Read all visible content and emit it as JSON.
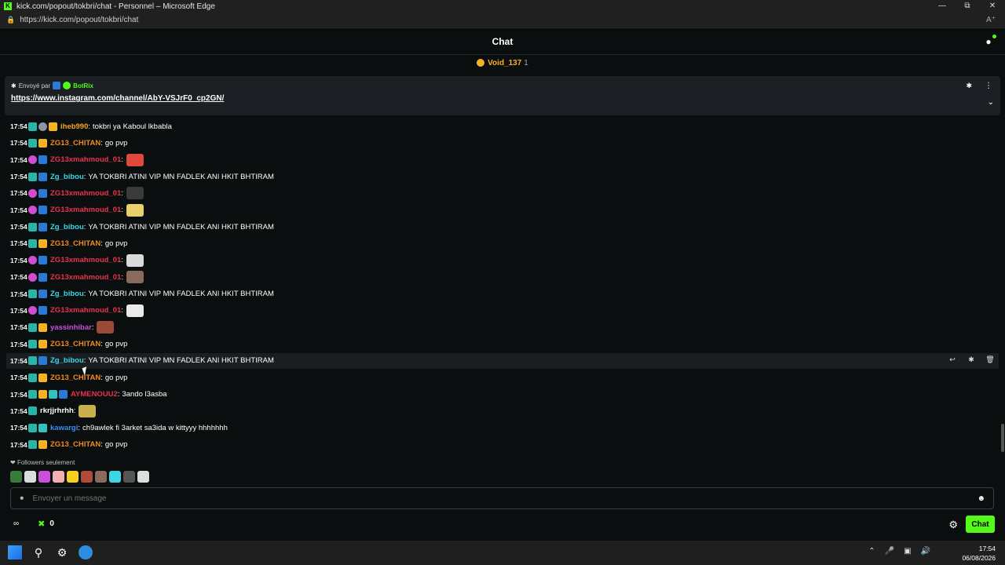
{
  "browser": {
    "window_title": "kick.com/popout/tokbri/chat - Personnel – Microsoft Edge",
    "url": "https://kick.com/popout/tokbri/chat",
    "reader_icon": "Aͅ"
  },
  "chat": {
    "title": "Chat",
    "top_gifter": {
      "name": "Void_137",
      "count": "1"
    },
    "pinned": {
      "sent_by_label": "Envoyé par",
      "sender": "BotRix",
      "link": "https://www.instagram.com/channel/AbY-VSJrF0_cp2GN/"
    },
    "messages": [
      {
        "time": "17:54",
        "badges": [
          "sub",
          "gray",
          "crown"
        ],
        "user": "iheb990",
        "color": "#f5a623",
        "text": "tokbri ya Kaboul lkbabla",
        "emote": ""
      },
      {
        "time": "17:54",
        "badges": [
          "sub",
          "crown"
        ],
        "user": "ZG13_CHITAN",
        "color": "#f58a1f",
        "text": "go pvp",
        "emote": ""
      },
      {
        "time": "17:54",
        "badges": [
          "pink",
          "star"
        ],
        "user": "ZG13xmahmoud_01",
        "color": "#e8334a",
        "text": "",
        "emote": "#e0483b"
      },
      {
        "time": "17:54",
        "badges": [
          "sub",
          "star"
        ],
        "user": "Zg_bibou",
        "color": "#3ed6e6",
        "text": "YA TOKBRI ATINI VIP MN FADLEK ANI HKIT BHTIRAM",
        "emote": ""
      },
      {
        "time": "17:54",
        "badges": [
          "pink",
          "star"
        ],
        "user": "ZG13xmahmoud_01",
        "color": "#e8334a",
        "text": "",
        "emote": "#3a3a3a"
      },
      {
        "time": "17:54",
        "badges": [
          "pink",
          "star"
        ],
        "user": "ZG13xmahmoud_01",
        "color": "#e8334a",
        "text": "",
        "emote": "#e8d06a"
      },
      {
        "time": "17:54",
        "badges": [
          "sub",
          "star"
        ],
        "user": "Zg_bibou",
        "color": "#3ed6e6",
        "text": "YA TOKBRI ATINI VIP MN FADLEK ANI HKIT BHTIRAM",
        "emote": ""
      },
      {
        "time": "17:54",
        "badges": [
          "sub",
          "crown"
        ],
        "user": "ZG13_CHITAN",
        "color": "#f58a1f",
        "text": "go pvp",
        "emote": ""
      },
      {
        "time": "17:54",
        "badges": [
          "pink",
          "star"
        ],
        "user": "ZG13xmahmoud_01",
        "color": "#e8334a",
        "text": "",
        "emote": "#d9d9d9"
      },
      {
        "time": "17:54",
        "badges": [
          "pink",
          "star"
        ],
        "user": "ZG13xmahmoud_01",
        "color": "#e8334a",
        "text": "",
        "emote": "#8a6a5a"
      },
      {
        "time": "17:54",
        "badges": [
          "sub",
          "star"
        ],
        "user": "Zg_bibou",
        "color": "#3ed6e6",
        "text": "YA TOKBRI ATINI VIP MN FADLEK ANI HKIT BHTIRAM",
        "emote": ""
      },
      {
        "time": "17:54",
        "badges": [
          "pink",
          "star"
        ],
        "user": "ZG13xmahmoud_01",
        "color": "#e8334a",
        "text": "",
        "emote": "#eaeaea"
      },
      {
        "time": "17:54",
        "badges": [
          "sub",
          "crown"
        ],
        "user": "yassinhibar",
        "color": "#c94fd8",
        "text": "",
        "emote": "#9b4a3a"
      },
      {
        "time": "17:54",
        "badges": [
          "sub",
          "crown"
        ],
        "user": "ZG13_CHITAN",
        "color": "#f58a1f",
        "text": "go pvp",
        "emote": ""
      },
      {
        "time": "17:54",
        "badges": [
          "sub",
          "star"
        ],
        "user": "Zg_bibou",
        "color": "#3ed6e6",
        "text": "YA TOKBRI ATINI VIP MN FADLEK ANI HKIT BHTIRAM",
        "emote": "",
        "hover": true
      },
      {
        "time": "17:54",
        "badges": [
          "sub",
          "crown"
        ],
        "user": "ZG13_CHITAN",
        "color": "#f58a1f",
        "text": "go pvp",
        "emote": ""
      },
      {
        "time": "17:54",
        "badges": [
          "sub",
          "crown",
          "grid",
          "star"
        ],
        "user": "AYMENOUU2",
        "color": "#e8334a",
        "text": "3ando l3asba",
        "emote": ""
      },
      {
        "time": "17:54",
        "badges": [
          "sub"
        ],
        "user": "rkrjjrhrhh",
        "color": "#ffffff",
        "text": "",
        "emote": "#c9b04a"
      },
      {
        "time": "17:54",
        "badges": [
          "sub",
          "grid"
        ],
        "user": "kawargi",
        "color": "#3a8ef0",
        "text": "ch9awlek fi 3arket sa3ida w kittyyy hhhhhhh",
        "emote": ""
      },
      {
        "time": "17:54",
        "badges": [
          "sub",
          "crown"
        ],
        "user": "ZG13_CHITAN",
        "color": "#f58a1f",
        "text": "go pvp",
        "emote": ""
      }
    ],
    "followers_only_label": "Followers seulement",
    "emote_colors": [
      "#3a7a3a",
      "#dcdcdc",
      "#c94fd8",
      "#f0b0b0",
      "#f5d020",
      "#b04a3a",
      "#8a6a5a",
      "#3ed6e6",
      "#555",
      "#ddd"
    ],
    "input_placeholder": "Envoyer un message",
    "points_value": "0",
    "chat_button": "Chat"
  },
  "taskbar": {
    "time": "17:54",
    "date": "06/08/2026"
  }
}
